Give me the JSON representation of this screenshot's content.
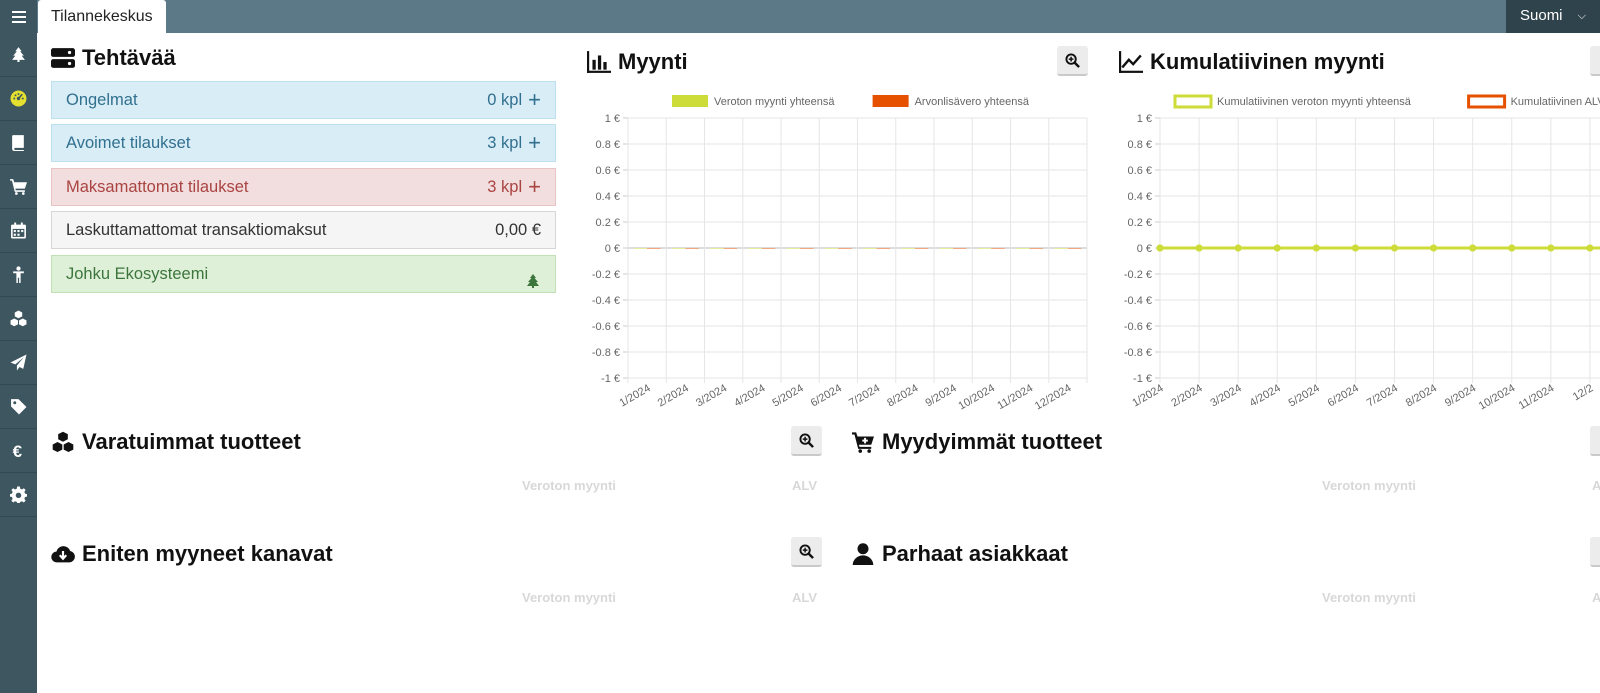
{
  "topbar": {
    "menu_icon": "hamburger-icon",
    "active_tab": "Tilannekeskus",
    "language": "Suomi"
  },
  "sidebar": {
    "items": [
      {
        "icon": "ecosystem-tree-icon"
      },
      {
        "icon": "dashboard-icon"
      },
      {
        "icon": "book-icon"
      },
      {
        "icon": "cart-icon"
      },
      {
        "icon": "calendar-icon"
      },
      {
        "icon": "person-icon"
      },
      {
        "icon": "cubes-icon"
      },
      {
        "icon": "paper-plane-icon"
      },
      {
        "icon": "tag-icon"
      },
      {
        "icon": "euro-icon"
      },
      {
        "icon": "gear-icon"
      }
    ]
  },
  "tasks": {
    "title": "Tehtävää",
    "items": [
      {
        "label": "Ongelmat",
        "value": "0 kpl",
        "action": "+"
      },
      {
        "label": "Avoimet tilaukset",
        "value": "3 kpl",
        "action": "+"
      },
      {
        "label": "Maksamattomat tilaukset",
        "value": "3 kpl",
        "action": "+"
      },
      {
        "label": "Laskuttamattomat transaktiomaksut",
        "value": "0,00 €",
        "action": ""
      },
      {
        "label": "Johku Ekosysteemi",
        "value": "",
        "action": ""
      }
    ]
  },
  "sales": {
    "title": "Myynti"
  },
  "cumulative": {
    "title": "Kumulatiivinen myynti"
  },
  "top_reserved": {
    "title": "Varatuimmat tuotteet",
    "col1": "Veroton myynti",
    "col2": "ALV"
  },
  "top_sold": {
    "title": "Myydyimmät tuotteet",
    "col1": "Veroton myynti",
    "col2": "A"
  },
  "top_channels": {
    "title": "Eniten myyneet kanavat",
    "col1": "Veroton myynti",
    "col2": "ALV"
  },
  "top_customers": {
    "title": "Parhaat asiakkaat",
    "col1": "Veroton myynti",
    "col2": "A"
  },
  "chart_data": [
    {
      "type": "bar",
      "title": "Myynti",
      "categories": [
        "1/2024",
        "2/2024",
        "3/2024",
        "4/2024",
        "5/2024",
        "6/2024",
        "7/2024",
        "8/2024",
        "9/2024",
        "10/2024",
        "11/2024",
        "12/2024"
      ],
      "series": [
        {
          "name": "Veroton myynti yhteensä",
          "color": "#cddc39",
          "values": [
            0,
            0,
            0,
            0,
            0,
            0,
            0,
            0,
            0,
            0,
            0,
            0
          ]
        },
        {
          "name": "Arvonlisävero yhteensä",
          "color": "#e65100",
          "values": [
            0,
            0,
            0,
            0,
            0,
            0,
            0,
            0,
            0,
            0,
            0,
            0
          ]
        }
      ],
      "yticks": [
        "1 €",
        "0.8 €",
        "0.6 €",
        "0.4 €",
        "0.2 €",
        "0 €",
        "-0.2 €",
        "-0.4 €",
        "-0.6 €",
        "-0.8 €",
        "-1 €"
      ],
      "ylim": [
        -1,
        1
      ],
      "grid": true,
      "legend": "top"
    },
    {
      "type": "line",
      "title": "Kumulatiivinen myynti",
      "categories": [
        "1/2024",
        "2/2024",
        "3/2024",
        "4/2024",
        "5/2024",
        "6/2024",
        "7/2024",
        "8/2024",
        "9/2024",
        "10/2024",
        "11/2024",
        "12/2"
      ],
      "series": [
        {
          "name": "Kumulatiivinen veroton myynti yhteensä",
          "color": "#cddc39",
          "values": [
            0,
            0,
            0,
            0,
            0,
            0,
            0,
            0,
            0,
            0,
            0,
            0
          ]
        },
        {
          "name": "Kumulatiivinen ALV",
          "color": "#e65100",
          "values": [
            0,
            0,
            0,
            0,
            0,
            0,
            0,
            0,
            0,
            0,
            0,
            0
          ]
        }
      ],
      "yticks": [
        "1 €",
        "0.8 €",
        "0.6 €",
        "0.4 €",
        "0.2 €",
        "0 €",
        "-0.2 €",
        "-0.4 €",
        "-0.6 €",
        "-0.8 €",
        "-1 €"
      ],
      "ylim": [
        -1,
        1
      ],
      "grid": true,
      "legend": "top"
    }
  ]
}
